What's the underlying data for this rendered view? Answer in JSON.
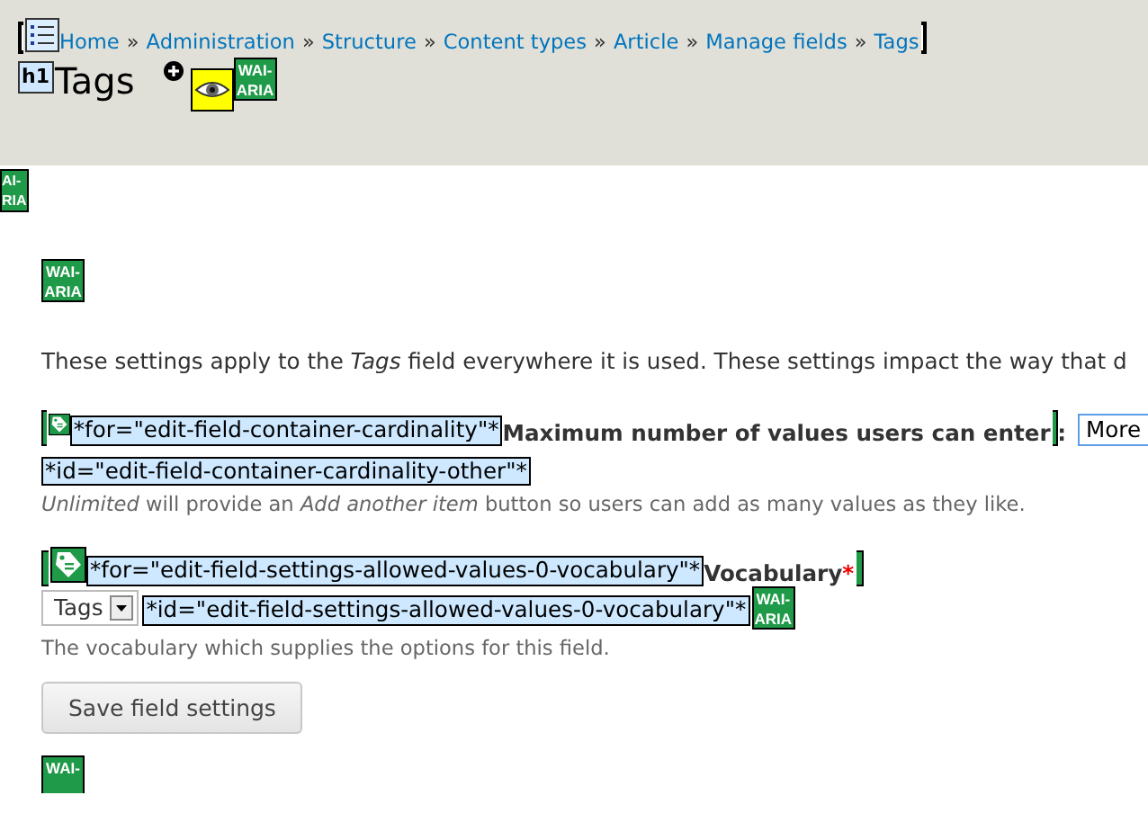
{
  "header": {
    "breadcrumb": [
      "Home",
      "Administration",
      "Structure",
      "Content types",
      "Article",
      "Manage fields",
      "Tags"
    ],
    "separator": "»",
    "heading_tag": "h1",
    "title": "Tags",
    "badge": [
      "WAI-",
      "ARIA"
    ]
  },
  "content": [
    {
      "kind": "badge",
      "lines": [
        "AI-",
        "RIA"
      ],
      "cut_left": true
    },
    {
      "kind": "badge",
      "lines": [
        "WAI-",
        "ARIA"
      ],
      "cut_left": false
    },
    {
      "kind": "paragraph",
      "text": "These settings apply to the *Tags* field everywhere it is used. These settings impact the way that d"
    },
    {
      "kind": "label_row",
      "for_text": "*for=\"edit-field-container-cardinality\"*",
      "label": "Maximum number of values users can enter",
      "required": false,
      "suffix": ":",
      "select": "More"
    },
    {
      "kind": "id_row",
      "id_text": "*id=\"edit-field-container-cardinality-other\"*"
    },
    {
      "kind": "description",
      "text": "*Unlimited* will provide an *Add another item* button so users can add as many values as they like."
    },
    {
      "kind": "label_row",
      "for_text": "*for=\"edit-field-settings-allowed-values-0-vocabulary\"*",
      "label": "Vocabulary",
      "required": true,
      "required_mark": "*"
    },
    {
      "kind": "select_row",
      "value": "Tags",
      "id_text": "*id=\"edit-field-settings-allowed-values-0-vocabulary\"*",
      "badge": [
        "WAI-",
        "ARIA"
      ]
    },
    {
      "kind": "description",
      "text": "The vocabulary which supplies the options for this field."
    },
    {
      "kind": "button",
      "label": "Save field settings"
    },
    {
      "kind": "badge",
      "lines": [
        "WAI-"
      ],
      "cut_left": false
    }
  ]
}
